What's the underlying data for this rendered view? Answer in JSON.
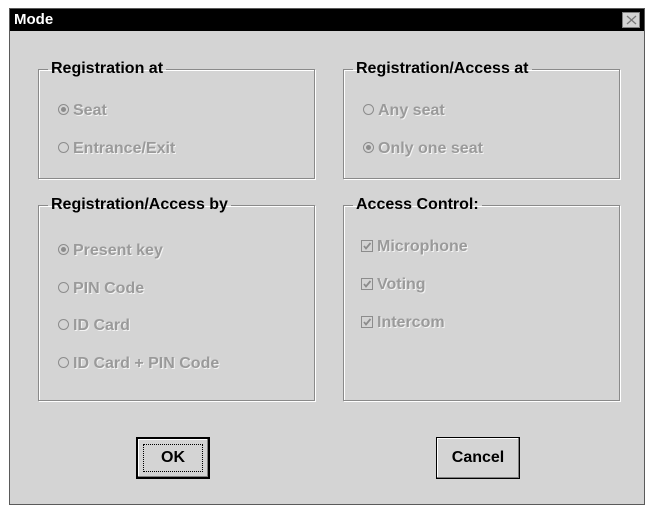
{
  "dialog": {
    "title": "Mode",
    "close_icon": "close-x-icon"
  },
  "groups": {
    "registration_at": {
      "label": "Registration at",
      "options": [
        {
          "label": "Seat",
          "checked": true
        },
        {
          "label": "Entrance/Exit",
          "checked": false
        }
      ]
    },
    "registration_access_at": {
      "label": "Registration/Access at",
      "options": [
        {
          "label": "Any seat",
          "checked": false
        },
        {
          "label": "Only one seat",
          "checked": true
        }
      ]
    },
    "registration_access_by": {
      "label": "Registration/Access by",
      "options": [
        {
          "label": "Present key",
          "checked": true
        },
        {
          "label": "PIN Code",
          "checked": false
        },
        {
          "label": "ID Card",
          "checked": false
        },
        {
          "label": "ID Card + PIN Code",
          "checked": false
        }
      ]
    },
    "access_control": {
      "label": "Access Control:",
      "options": [
        {
          "label": "Microphone",
          "checked": true
        },
        {
          "label": "Voting",
          "checked": true
        },
        {
          "label": "Intercom",
          "checked": true
        }
      ]
    }
  },
  "buttons": {
    "ok_label": "OK",
    "cancel_label": "Cancel"
  },
  "state": {
    "options_enabled": false
  },
  "colors": {
    "dialog_bg": "#d4d4d4",
    "titlebar_bg": "#000000",
    "disabled_text": "#9a9a9a"
  }
}
